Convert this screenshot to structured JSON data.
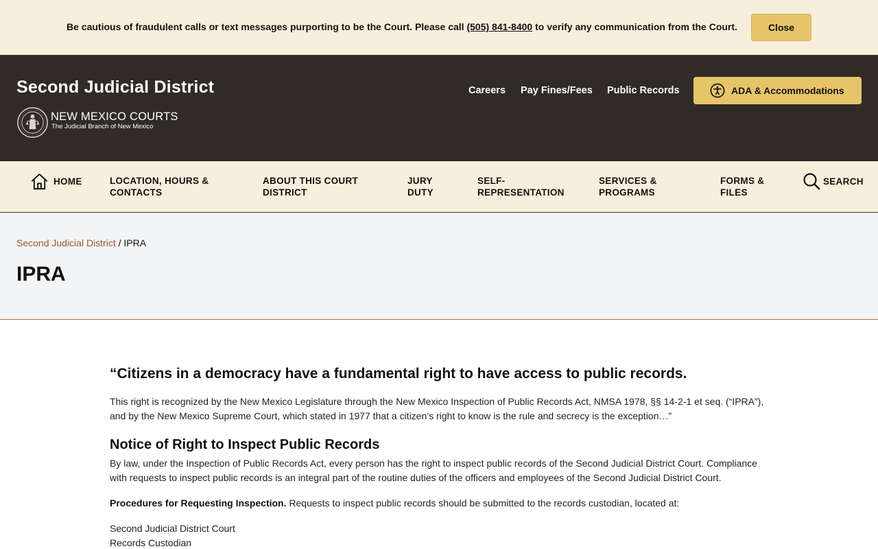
{
  "alert": {
    "text_before": "Be cautious of fraudulent calls or text messages purporting to be the Court. Please call ",
    "phone": "(505) 841-8400",
    "text_after": " to verify any communication from the Court.",
    "close_label": "Close"
  },
  "header": {
    "site_title": "Second Judicial District",
    "logo_name": "NEW MEXICO COURTS",
    "logo_tagline": "The Judicial Branch of New Mexico",
    "links": [
      "Careers",
      "Pay Fines/Fees",
      "Public Records"
    ],
    "ada_label": "ADA & Accommodations"
  },
  "nav": {
    "home": "HOME",
    "items": [
      [
        "LOCATION, HOURS &",
        "CONTACTS"
      ],
      [
        "ABOUT THIS COURT",
        "DISTRICT"
      ],
      [
        "JURY",
        "DUTY"
      ],
      [
        "SELF-",
        "REPRESENTATION"
      ],
      [
        "SERVICES &",
        "PROGRAMS"
      ],
      [
        "FORMS &",
        "FILES"
      ]
    ],
    "search": "SEARCH"
  },
  "breadcrumb": {
    "home": "Second Judicial District",
    "separator": " / ",
    "current": "IPRA"
  },
  "page_title": "IPRA",
  "content": {
    "quote_heading": "“Citizens in a democracy have a fundamental right to have access to public records.",
    "quote_para_1": "This right is recognized by the New Mexico Legislature through the New Mexico Inspection of Public Records Act, NMSA 1978, §§ 14-2-1 et seq. (“IPRA”),",
    "quote_para_2": "and by the New Mexico Supreme Court, which stated in 1977 that a citizen’s right to know is the rule and secrecy is the exception…”",
    "notice_heading": "Notice of Right to Inspect Public Records",
    "notice_para_1": "By law, under the Inspection of Public Records Act, every person has the right to inspect public records of the Second Judicial District Court. Compliance",
    "notice_para_2": "with requests to inspect public records is an integral part of the routine duties of the officers and employees of the Second Judicial District Court.",
    "procedures_label": "Procedures for Requesting Inspection.",
    "procedures_text": " Requests to inspect public records should be submitted to the records custodian, located at:",
    "address_1": "Second Judicial District Court",
    "address_2": "Records Custodian"
  }
}
